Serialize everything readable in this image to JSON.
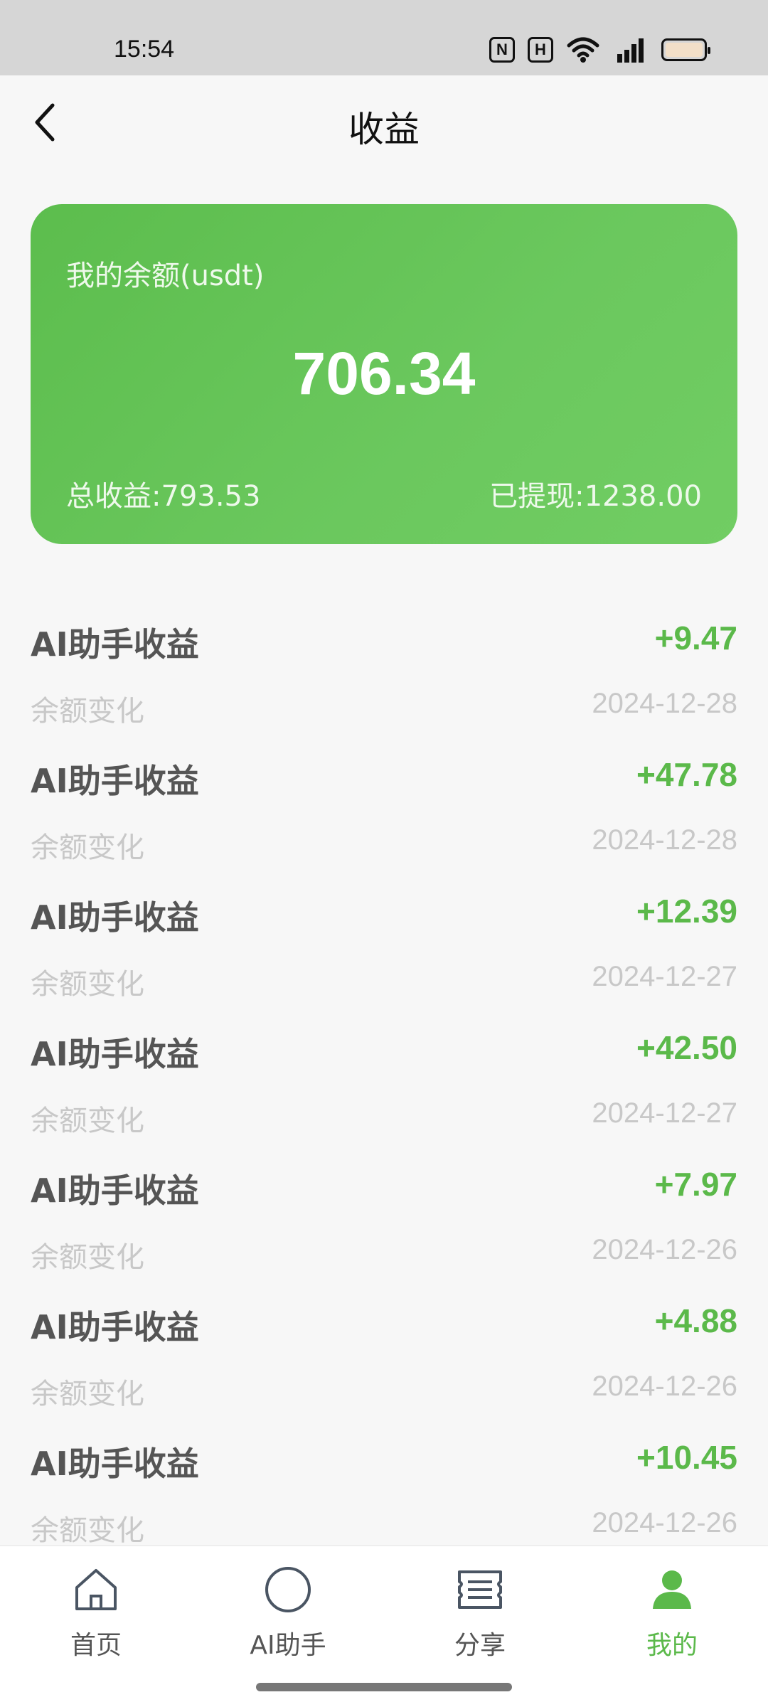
{
  "status_bar": {
    "time": "15:54",
    "icons": [
      "nfc-icon",
      "hd-icon",
      "wifi-icon",
      "signal-4g-icon",
      "battery-icon"
    ],
    "nfc_label": "N",
    "hd_label": "H"
  },
  "header": {
    "title": "收益",
    "back_icon": "chevron-left-icon"
  },
  "balance_card": {
    "label": "我的余额(usdt)",
    "balance": "706.34",
    "total_income": "总收益:793.53",
    "withdrawn": "已提现:1238.00"
  },
  "transactions": [
    {
      "title": "AI助手收益",
      "amount": "+9.47",
      "subtitle": "余额变化",
      "date": "2024-12-28"
    },
    {
      "title": "AI助手收益",
      "amount": "+47.78",
      "subtitle": "余额变化",
      "date": "2024-12-28"
    },
    {
      "title": "AI助手收益",
      "amount": "+12.39",
      "subtitle": "余额变化",
      "date": "2024-12-27"
    },
    {
      "title": "AI助手收益",
      "amount": "+42.50",
      "subtitle": "余额变化",
      "date": "2024-12-27"
    },
    {
      "title": "AI助手收益",
      "amount": "+7.97",
      "subtitle": "余额变化",
      "date": "2024-12-26"
    },
    {
      "title": "AI助手收益",
      "amount": "+4.88",
      "subtitle": "余额变化",
      "date": "2024-12-26"
    },
    {
      "title": "AI助手收益",
      "amount": "+10.45",
      "subtitle": "余额变化",
      "date": "2024-12-26"
    }
  ],
  "tabbar": {
    "tabs": [
      {
        "label": "首页",
        "icon": "home-icon"
      },
      {
        "label": "AI助手",
        "icon": "circle-icon"
      },
      {
        "label": "分享",
        "icon": "ticket-icon"
      },
      {
        "label": "我的",
        "icon": "user-icon"
      }
    ],
    "active_tab": "我的"
  },
  "colors": {
    "accent": "#5bb94a",
    "card_gradient_start": "#5cbd4d",
    "card_gradient_end": "#71cd63",
    "muted_text": "#c8c8c8"
  }
}
